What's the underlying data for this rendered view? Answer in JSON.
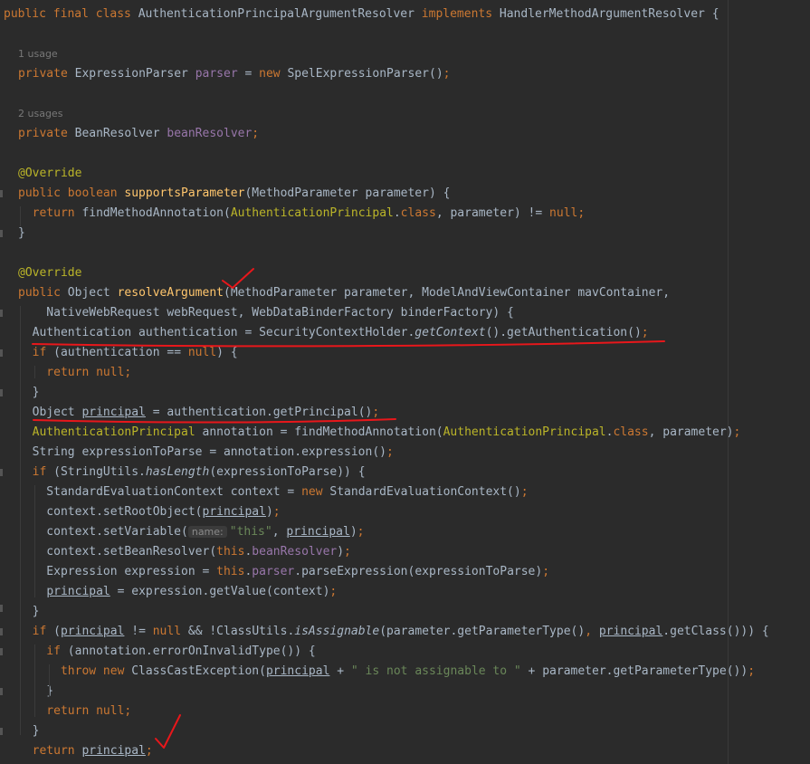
{
  "editor": {
    "code_lines": [
      {
        "kind": "code",
        "tokens": [
          {
            "t": "public final class ",
            "c": "kw"
          },
          {
            "t": "AuthenticationPrincipalArgumentResolver "
          },
          {
            "t": "implements ",
            "c": "kw"
          },
          {
            "t": "HandlerMethodArgumentResolver {"
          }
        ]
      },
      {
        "kind": "code",
        "tokens": []
      },
      {
        "kind": "hint",
        "text": "1 usage"
      },
      {
        "kind": "code",
        "tokens": [
          {
            "t": "private ",
            "c": "kw"
          },
          {
            "t": "ExpressionParser "
          },
          {
            "t": "parser",
            "c": "fld"
          },
          {
            "t": " = "
          },
          {
            "t": "new ",
            "c": "kw"
          },
          {
            "t": "SpelExpressionParser()"
          },
          {
            "t": ";",
            "c": "kw"
          }
        ]
      },
      {
        "kind": "code",
        "tokens": []
      },
      {
        "kind": "hint",
        "text": "2 usages"
      },
      {
        "kind": "code",
        "tokens": [
          {
            "t": "private ",
            "c": "kw"
          },
          {
            "t": "BeanResolver "
          },
          {
            "t": "beanResolver",
            "c": "fld"
          },
          {
            "t": ";",
            "c": "kw"
          }
        ]
      },
      {
        "kind": "code",
        "tokens": []
      },
      {
        "kind": "code",
        "tokens": [
          {
            "t": "@Override",
            "c": "ann"
          }
        ]
      },
      {
        "kind": "code",
        "tokens": [
          {
            "t": "public boolean ",
            "c": "kw"
          },
          {
            "t": "supportsParameter",
            "c": "meth"
          },
          {
            "t": "(MethodParameter parameter) {"
          }
        ]
      },
      {
        "kind": "code",
        "tokens": [
          {
            "t": "  return ",
            "c": "kw"
          },
          {
            "t": "findMethodAnnotation("
          },
          {
            "t": "AuthenticationPrincipal",
            "c": "ann"
          },
          {
            "t": "."
          },
          {
            "t": "class",
            "c": "kw"
          },
          {
            "t": ", parameter) != "
          },
          {
            "t": "null",
            "c": "kw"
          },
          {
            "t": ";",
            "c": "kw"
          }
        ]
      },
      {
        "kind": "code",
        "tokens": [
          {
            "t": "}"
          }
        ]
      },
      {
        "kind": "code",
        "tokens": []
      },
      {
        "kind": "code",
        "tokens": [
          {
            "t": "@Override",
            "c": "ann"
          }
        ]
      },
      {
        "kind": "code",
        "tokens": [
          {
            "t": "public ",
            "c": "kw"
          },
          {
            "t": "Object "
          },
          {
            "t": "resolveArgument",
            "c": "meth"
          },
          {
            "t": "(MethodParameter parameter, ModelAndViewContainer mavContainer,"
          }
        ]
      },
      {
        "kind": "code",
        "tokens": [
          {
            "t": "    NativeWebRequest webRequest, WebDataBinderFactory binderFactory) {"
          }
        ]
      },
      {
        "kind": "code",
        "tokens": [
          {
            "t": "  Authentication authentication = SecurityContextHolder."
          },
          {
            "t": "getContext",
            "c": "it"
          },
          {
            "t": "().getAuthentication()"
          },
          {
            "t": ";",
            "c": "kw"
          }
        ]
      },
      {
        "kind": "code",
        "tokens": [
          {
            "t": "  if ",
            "c": "kw"
          },
          {
            "t": "(authentication == "
          },
          {
            "t": "null",
            "c": "kw"
          },
          {
            "t": ") {"
          }
        ]
      },
      {
        "kind": "code",
        "tokens": [
          {
            "t": "    return null;",
            "c": "kw"
          }
        ]
      },
      {
        "kind": "code",
        "tokens": [
          {
            "t": "  }"
          }
        ]
      },
      {
        "kind": "code",
        "tokens": [
          {
            "t": "  Object "
          },
          {
            "t": "principal",
            "c": "ul"
          },
          {
            "t": " = authentication.getPrincipal()"
          },
          {
            "t": ";",
            "c": "kw"
          }
        ]
      },
      {
        "kind": "code",
        "tokens": [
          {
            "t": "  AuthenticationPrincipal",
            "c": "ann"
          },
          {
            "t": " annotation = findMethodAnnotation("
          },
          {
            "t": "AuthenticationPrincipal",
            "c": "ann"
          },
          {
            "t": "."
          },
          {
            "t": "class",
            "c": "kw"
          },
          {
            "t": ", parameter)"
          },
          {
            "t": ";",
            "c": "kw"
          }
        ]
      },
      {
        "kind": "code",
        "tokens": [
          {
            "t": "  String expressionToParse = annotation.expression()"
          },
          {
            "t": ";",
            "c": "kw"
          }
        ]
      },
      {
        "kind": "code",
        "tokens": [
          {
            "t": "  if ",
            "c": "kw"
          },
          {
            "t": "(StringUtils."
          },
          {
            "t": "hasLength",
            "c": "it"
          },
          {
            "t": "(expressionToParse)) {"
          }
        ]
      },
      {
        "kind": "code",
        "tokens": [
          {
            "t": "    StandardEvaluationContext context = "
          },
          {
            "t": "new ",
            "c": "kw"
          },
          {
            "t": "StandardEvaluationContext()"
          },
          {
            "t": ";",
            "c": "kw"
          }
        ]
      },
      {
        "kind": "code",
        "tokens": [
          {
            "t": "    context.setRootObject("
          },
          {
            "t": "principal",
            "c": "ul"
          },
          {
            "t": ")"
          },
          {
            "t": ";",
            "c": "kw"
          }
        ]
      },
      {
        "kind": "code",
        "tokens": [
          {
            "t": "    context.setVariable("
          },
          {
            "t": "name:",
            "c": "inlay"
          },
          {
            "t": "\"this\"",
            "c": "str"
          },
          {
            "t": ", "
          },
          {
            "t": "principal",
            "c": "ul"
          },
          {
            "t": ")"
          },
          {
            "t": ";",
            "c": "kw"
          }
        ]
      },
      {
        "kind": "code",
        "tokens": [
          {
            "t": "    context.setBeanResolver("
          },
          {
            "t": "this",
            "c": "kw"
          },
          {
            "t": "."
          },
          {
            "t": "beanResolver",
            "c": "fld"
          },
          {
            "t": ")"
          },
          {
            "t": ";",
            "c": "kw"
          }
        ]
      },
      {
        "kind": "code",
        "tokens": [
          {
            "t": "    Expression expression = "
          },
          {
            "t": "this",
            "c": "kw"
          },
          {
            "t": "."
          },
          {
            "t": "parser",
            "c": "fld"
          },
          {
            "t": ".parseExpression(expressionToParse)"
          },
          {
            "t": ";",
            "c": "kw"
          }
        ]
      },
      {
        "kind": "code",
        "tokens": [
          {
            "t": "    "
          },
          {
            "t": "principal",
            "c": "ul"
          },
          {
            "t": " = expression.getValue(context)"
          },
          {
            "t": ";",
            "c": "kw"
          }
        ]
      },
      {
        "kind": "code",
        "tokens": [
          {
            "t": "  }"
          }
        ]
      },
      {
        "kind": "code",
        "tokens": [
          {
            "t": "  if ",
            "c": "kw"
          },
          {
            "t": "("
          },
          {
            "t": "principal",
            "c": "ul"
          },
          {
            "t": " != "
          },
          {
            "t": "null ",
            "c": "kw"
          },
          {
            "t": "&& !ClassUtils."
          },
          {
            "t": "isAssignable",
            "c": "it"
          },
          {
            "t": "(parameter.getParameterType()"
          },
          {
            "t": ", ",
            "c": "kw"
          },
          {
            "t": "principal",
            "c": "ul"
          },
          {
            "t": ".getClass())) {"
          }
        ]
      },
      {
        "kind": "code",
        "tokens": [
          {
            "t": "    if ",
            "c": "kw"
          },
          {
            "t": "(annotation.errorOnInvalidType()) {"
          }
        ]
      },
      {
        "kind": "code",
        "tokens": [
          {
            "t": "      throw new ",
            "c": "kw"
          },
          {
            "t": "ClassCastException("
          },
          {
            "t": "principal",
            "c": "ul"
          },
          {
            "t": " + "
          },
          {
            "t": "\" is not assignable to \"",
            "c": "str"
          },
          {
            "t": " + parameter.getParameterType())"
          },
          {
            "t": ";",
            "c": "kw"
          }
        ]
      },
      {
        "kind": "code",
        "tokens": [
          {
            "t": "    }"
          }
        ]
      },
      {
        "kind": "code",
        "tokens": [
          {
            "t": "    return null;",
            "c": "kw"
          }
        ]
      },
      {
        "kind": "code",
        "tokens": [
          {
            "t": "  }"
          }
        ]
      },
      {
        "kind": "code",
        "tokens": [
          {
            "t": "  return ",
            "c": "kw"
          },
          {
            "t": "principal",
            "c": "ul"
          },
          {
            "t": ";",
            "c": "kw"
          }
        ]
      }
    ],
    "annotation_color": "#e8171b"
  }
}
